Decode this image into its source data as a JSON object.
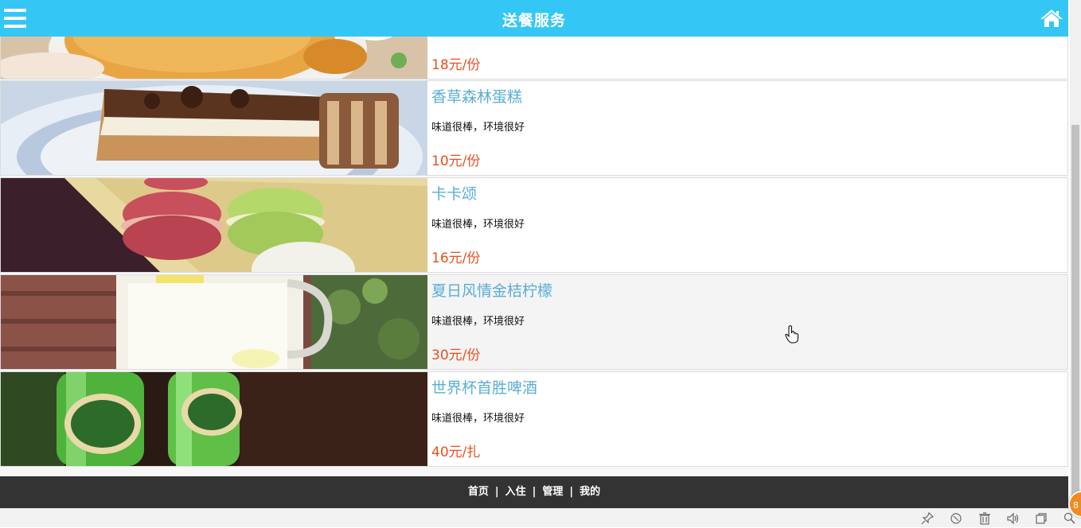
{
  "header": {
    "title": "送餐服务",
    "menu_icon": "hamburger-menu-icon",
    "home_icon": "home-icon",
    "background": "#34c7f5"
  },
  "items": [
    {
      "name": "",
      "desc": "",
      "price": "18元/份",
      "image": "cake-dessert-photo"
    },
    {
      "name": "香草森林蛋糕",
      "desc": "味道很棒，环境很好",
      "price": "10元/份",
      "image": "tiramisu-cake-photo"
    },
    {
      "name": "卡卡颂",
      "desc": "味道很棒，环境很好",
      "price": "16元/份",
      "image": "macarons-photo"
    },
    {
      "name": "夏日风情金桔柠檬",
      "desc": "味道很棒，环境很好",
      "price": "30元/份",
      "image": "lemonade-pitcher-photo"
    },
    {
      "name": "世界杯首胜啤酒",
      "desc": "味道很棒，环境很好",
      "price": "40元/扎",
      "image": "green-bottles-photo"
    }
  ],
  "footer": {
    "links": [
      "首页",
      "入住",
      "管理",
      "我的"
    ],
    "separator": "|"
  },
  "statusbar": {
    "icons": [
      "pin-icon",
      "refresh-icon",
      "trash-icon",
      "speaker-icon",
      "window-icon",
      "search-icon"
    ],
    "badge": "8"
  },
  "colors": {
    "name": "#5aaed6",
    "price": "#e8501e",
    "footer": "#333333"
  }
}
